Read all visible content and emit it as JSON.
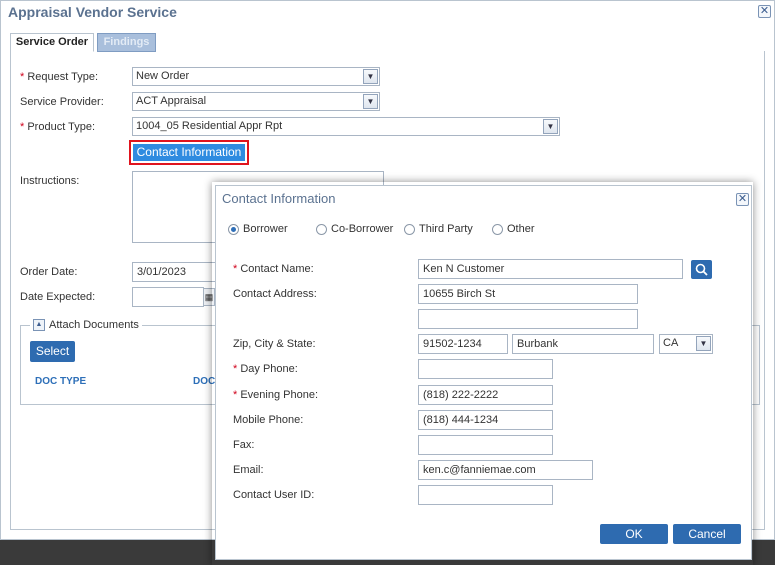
{
  "window": {
    "title": "Appraisal Vendor Service",
    "close_glyph": "✕"
  },
  "tabs": [
    {
      "label": "Service Order",
      "active": true
    },
    {
      "label": "Findings",
      "active": false
    }
  ],
  "form": {
    "request_type": {
      "label": "Request Type:",
      "required": true,
      "value": "New Order"
    },
    "service_provider": {
      "label": "Service Provider:",
      "required": false,
      "value": "ACT Appraisal"
    },
    "product_type": {
      "label": "Product Type:",
      "required": true,
      "value": "1004_05 Residential Appr Rpt"
    },
    "contact_button": "Contact Information",
    "instructions_label": "Instructions:",
    "order_date": {
      "label": "Order Date:",
      "value": "3/01/2023"
    },
    "date_expected": {
      "label": "Date Expected:",
      "value": ""
    },
    "attach": {
      "legend": "Attach Documents",
      "select_button": "Select",
      "columns": [
        "DOC TYPE",
        "DOCU"
      ]
    }
  },
  "contact_modal": {
    "title": "Contact Information",
    "close_glyph": "✕",
    "radio_options": [
      {
        "label": "Borrower",
        "selected": true
      },
      {
        "label": "Co-Borrower",
        "selected": false
      },
      {
        "label": "Third Party",
        "selected": false
      },
      {
        "label": "Other",
        "selected": false
      }
    ],
    "fields": {
      "contact_name": {
        "label": "Contact Name:",
        "required": true,
        "value": "Ken N Customer"
      },
      "contact_address": {
        "label": "Contact Address:",
        "line1": "10655 Birch St",
        "line2": ""
      },
      "zip_city_state": {
        "label": "Zip, City & State:",
        "zip": "91502-1234",
        "city": "Burbank",
        "state": "CA"
      },
      "day_phone": {
        "label": "Day Phone:",
        "required": true,
        "value": ""
      },
      "evening_phone": {
        "label": "Evening Phone:",
        "required": true,
        "value": "(818) 222-2222"
      },
      "mobile_phone": {
        "label": "Mobile Phone:",
        "value": "(818) 444-1234"
      },
      "fax": {
        "label": "Fax:",
        "value": ""
      },
      "email": {
        "label": "Email:",
        "value": "ken.c@fanniemae.com"
      },
      "contact_user_id": {
        "label": "Contact User ID:",
        "value": ""
      }
    },
    "ok_button": "OK",
    "cancel_button": "Cancel"
  },
  "colors": {
    "accent": "#2e6bb0",
    "highlight_border": "#e0141e",
    "title_text": "#5b7290",
    "required": "#d0021b"
  },
  "icons": {
    "dropdown": "chevron-down-icon",
    "search": "search-icon",
    "calendar": "calendar-icon",
    "collapse": "collapse-up-icon"
  }
}
